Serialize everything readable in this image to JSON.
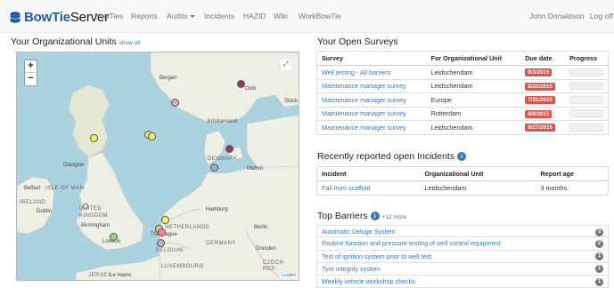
{
  "brand": {
    "name_bold": "BowTie",
    "name_rest": "Server"
  },
  "nav": {
    "items": [
      "BowTies",
      "Reports",
      "Audits",
      "Incidents",
      "HAZID",
      "Wiki",
      "WorkBowTie"
    ],
    "user": "John Donaldson",
    "logoff": "Log off"
  },
  "units": {
    "title": "Your Organizational Units",
    "show_all": "show all",
    "map": {
      "zoom_in": "+",
      "zoom_out": "−",
      "attribution": "Leaflet",
      "labels": [
        "Bergen",
        "Oslo",
        "Stock",
        "Kristiansand",
        "DENMARK",
        "Malmö",
        "Glasgow",
        "Belfast",
        "ISLE OF MAN",
        "IRELAND",
        "Dublin",
        "UNITED KINGDOM",
        "Birmingham",
        "London",
        "NETHERLANDS",
        "The Hague",
        "BELGIUM",
        "LUXEMBOURG",
        "Hamburg",
        "Berlin",
        "GERMANY",
        "Dresden",
        "CZECH REP.",
        "JERSEY",
        "Le Havre"
      ],
      "marker_colors": [
        "#e9a3c9",
        "#8e3a63",
        "#f6f06b",
        "#e8e86a",
        "#8e3a63",
        "#8fb2d6",
        "#f2ee7a",
        "#9ed08d",
        "#f6f06b",
        "#f4c36d",
        "#c8a4e0",
        "#ec8b8b"
      ]
    }
  },
  "surveys": {
    "title": "Your Open Surveys",
    "headers": [
      "Survey",
      "For Organizational Unit",
      "Due date",
      "Progress"
    ],
    "rows": [
      {
        "survey": "Well testing - All barriers",
        "unit": "Leidschendam",
        "due": "9/3/2015"
      },
      {
        "survey": "Maintenance manager survey",
        "unit": "Leidschendam",
        "due": "8/20/2015"
      },
      {
        "survey": "Maintenance manager survey",
        "unit": "Europe",
        "due": "7/31/2015"
      },
      {
        "survey": "Maintenance manager survey",
        "unit": "Rotterdam",
        "due": "8/6/2015"
      },
      {
        "survey": "Maintenance manager survey",
        "unit": "Leidschendam",
        "due": "8/27/2015"
      }
    ],
    "progress": [
      0,
      0,
      0,
      0,
      0
    ]
  },
  "incidents": {
    "title": "Recently reported open Incidents",
    "headers": [
      "Incident",
      "Organizational Unit",
      "Report age"
    ],
    "rows": [
      {
        "incident": "Fall from scaffold",
        "unit": "Leidschendam",
        "age": "3 months"
      }
    ]
  },
  "barriers": {
    "title": "Top Barriers",
    "more": "+12 more",
    "items": [
      {
        "name": "Automatic Deluge System",
        "count": "3"
      },
      {
        "name": "Routine function and pressure testing of well control equipment",
        "count": "2"
      },
      {
        "name": "Test of ignition system prior to well test",
        "count": "1"
      },
      {
        "name": "Tyre integrity system",
        "count": "1"
      },
      {
        "name": "Weekly vehicle workshop checks",
        "count": "1"
      }
    ]
  },
  "colors": {
    "accent": "#337ab7",
    "danger": "#d9534f",
    "badge": "#777777"
  }
}
